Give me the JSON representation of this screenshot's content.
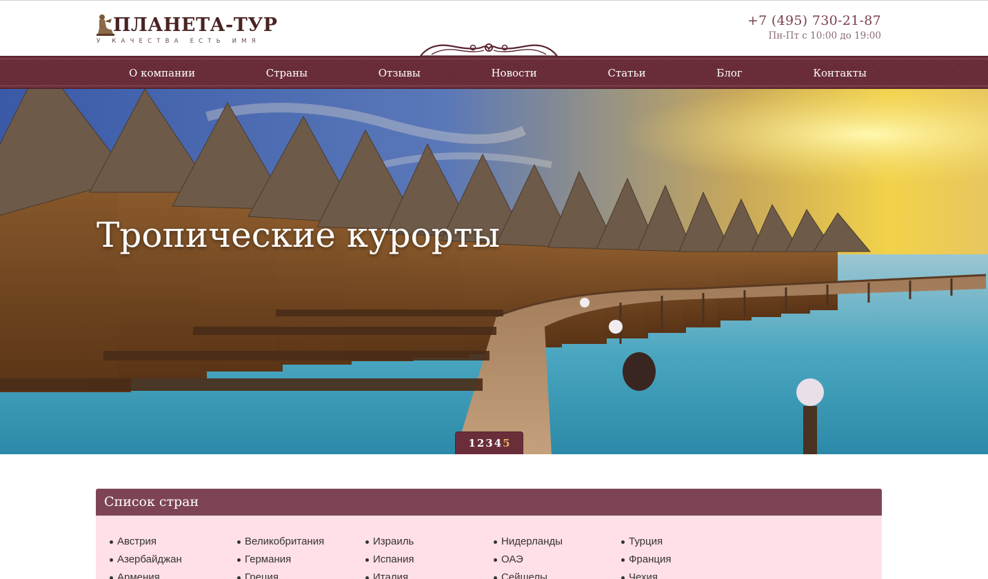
{
  "header": {
    "logo_title": "ПЛАНЕТА-ТУР",
    "logo_tagline": "У КАЧЕСТВА ЕСТЬ ИМЯ",
    "phone": "+7 (495) 730-21-87",
    "hours": "Пн-Пт с 10:00 до 19:00"
  },
  "nav": {
    "items": [
      {
        "label": "О компании"
      },
      {
        "label": "Страны"
      },
      {
        "label": "Отзывы"
      },
      {
        "label": "Новости"
      },
      {
        "label": "Статьи"
      },
      {
        "label": "Блог"
      },
      {
        "label": "Контакты"
      }
    ]
  },
  "hero": {
    "caption": "Тропические курорты",
    "pager": [
      "1",
      "2",
      "3",
      "4",
      "5"
    ],
    "active_page": "5"
  },
  "countries": {
    "title": "Список стран",
    "columns": [
      [
        "Австрия",
        "Азербайджан",
        "Армения"
      ],
      [
        "Великобритания",
        "Германия",
        "Греция"
      ],
      [
        "Израиль",
        "Испания",
        "Италия"
      ],
      [
        "Нидерланды",
        "ОАЭ",
        "Сейшелы"
      ],
      [
        "Турция",
        "Франция",
        "Чехия"
      ]
    ]
  },
  "colors": {
    "brand": "#6e2f3c",
    "panel_header": "#7d4553",
    "panel_body": "#ffe0e6",
    "pager_active": "#e5b15e"
  },
  "icons": {
    "logo": "statue-emblem-icon",
    "divider": "ornament-flourish-icon"
  }
}
